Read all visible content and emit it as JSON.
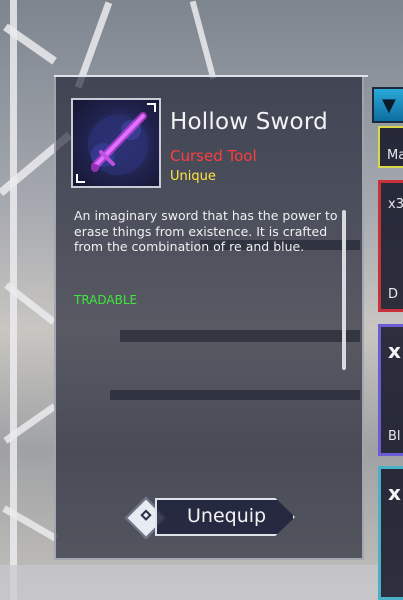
{
  "item": {
    "name": "Hollow Sword",
    "type": "Cursed Tool",
    "rarity": "Unique",
    "description": "An imaginary sword that has the power to erase things from existence. It is crafted from the combination of re and blue.",
    "tradable": "TRADABLE",
    "icon": "cursed-sword-icon"
  },
  "actions": {
    "unequip": "Unequip"
  },
  "inventory": {
    "dropdown_icon": "▼",
    "slots": [
      {
        "label_top": "",
        "label_bottom": "Ma",
        "color": "#d8d84a"
      },
      {
        "label_top": "x3",
        "label_bottom": "D",
        "color": "#c8303a"
      },
      {
        "label_top": "x",
        "label_bottom": "Bl",
        "color": "#6a5cd6"
      },
      {
        "label_top": "x",
        "label_bottom": "",
        "color": "#4ab0c8"
      }
    ]
  },
  "colors": {
    "cursed": "#ff3d3d",
    "unique": "#ffe640",
    "tradable": "#3de83d"
  }
}
